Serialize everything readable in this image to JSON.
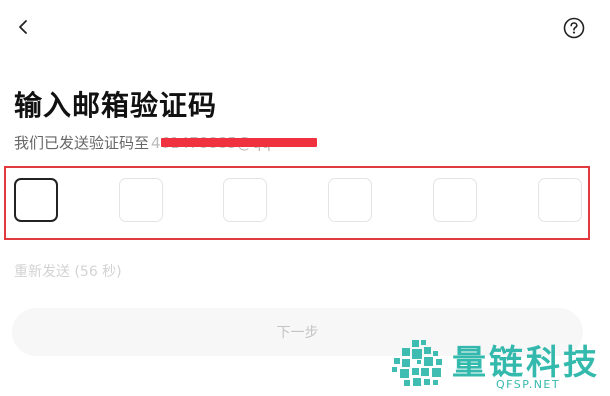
{
  "header": {
    "back_icon": "chevron-left-icon",
    "help_icon": "question-circle-icon"
  },
  "title": "输入邮箱验证码",
  "subtitle": {
    "prefix": "我们已发送验证码至",
    "email": "461478885@qq"
  },
  "code_boxes": [
    "",
    "",
    "",
    "",
    "",
    ""
  ],
  "resend": "重新发送 (56 秒)",
  "next_button": "下一步",
  "watermark": {
    "name": "量链科技",
    "url": "QFSP.NET"
  },
  "colors": {
    "redaction": "#f0313f",
    "highlight_frame": "#e0393e",
    "watermark": "#1fb2a5"
  }
}
